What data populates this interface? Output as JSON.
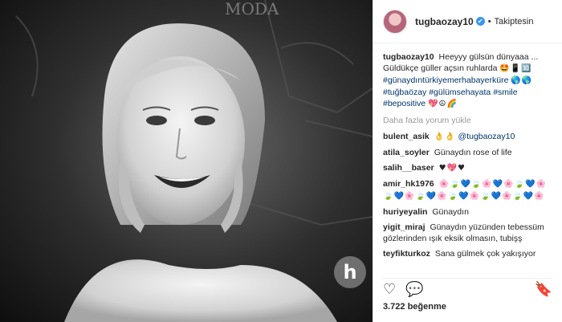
{
  "header": {
    "username": "tugbaozay10",
    "verified_glyph": "✔",
    "separator": "•",
    "follow_status": "Takiptesin"
  },
  "caption": {
    "username": "tugbaozay10",
    "line1": "Heeyyy gülsün dünyaaa ...",
    "line2": "Güldükçe güller açsın ruhlarda",
    "emoji1": "🤩📱🔟",
    "tag1": "#günaydıntürkiyemerhabayerküre",
    "emoji2": "🌎🌎",
    "tag2": "#tuğbaözay",
    "tag3": "#gülümsehayata",
    "tag4": "#smile",
    "tag5": "#bepositive",
    "emoji3": "💖☮🌈"
  },
  "load_more": "Daha fazla yorum yükle",
  "comments": [
    {
      "user": "bulent_asik",
      "emoji": "👌👌",
      "mention": "@tugbaozay10",
      "text": ""
    },
    {
      "user": "atila_soyler",
      "emoji": "",
      "mention": "",
      "text": "Günaydın rose of life"
    },
    {
      "user": "salih__baser",
      "emoji": "♥💖♥",
      "mention": "",
      "text": ""
    },
    {
      "user": "amir_hk1976",
      "emoji": "🌸🍃💙🍃🌸💙🌸🍃💙🌸🍃💙🌸🍃💙🌸🍃💙🌸🍃💙🌸🍃💙🌸",
      "mention": "",
      "text": ""
    },
    {
      "user": "huriyeyalin",
      "emoji": "",
      "mention": "",
      "text": "Günaydın"
    },
    {
      "user": "yigit_miraj",
      "emoji": "",
      "mention": "",
      "text": "Günaydın yüzünden tebessüm gözlerinden ışık eksik olmasın, tubişş"
    },
    {
      "user": "teyfikturkoz",
      "emoji": "",
      "mention": "",
      "text": "Sana gülmek çok yakışıyor"
    }
  ],
  "actions": {
    "like_icon": "♡",
    "comment_icon": "💬",
    "save_icon": "🔖"
  },
  "likes_text": "3.722 beğenme",
  "photo": {
    "watermark": "h",
    "sign_text": "MODA"
  }
}
